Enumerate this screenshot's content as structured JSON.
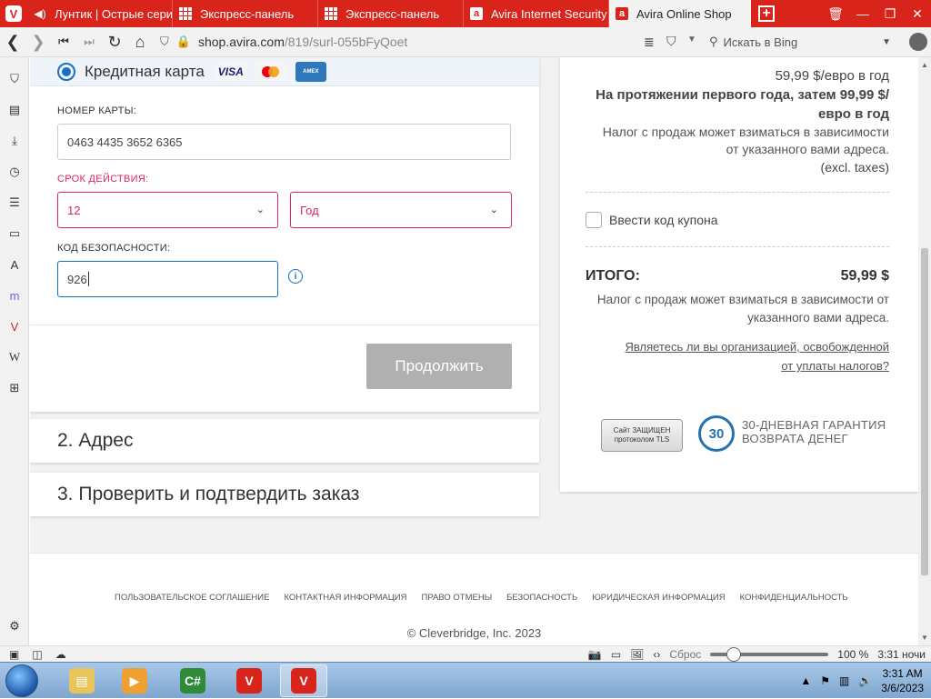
{
  "tabs": [
    {
      "label": "Лунтик | Острые серии",
      "icon": "speaker-icon"
    },
    {
      "label": "Экспресс-панель",
      "icon": "grid-icon"
    },
    {
      "label": "Экспресс-панель",
      "icon": "grid-icon"
    },
    {
      "label": "Avira Internet Security -",
      "icon": "avira-icon"
    },
    {
      "label": "Avira Online Shop",
      "icon": "avira-icon",
      "active": true
    }
  ],
  "address": {
    "host": "shop.avira.com",
    "path": "/819/surl-055bFyQoet",
    "search_placeholder": "Искать в Bing"
  },
  "payment": {
    "method_label": "Кредитная карта",
    "visa_label": "VISA",
    "amex_label": "AMEX",
    "card_number_label": "НОМЕР КАРТЫ:",
    "card_number_value": "0463 4435 3652 6365",
    "expiry_label": "СРОК ДЕЙСТВИЯ:",
    "expiry_month": "12",
    "expiry_year_placeholder": "Год",
    "cvv_label": "КОД БЕЗОПАСНОСТИ:",
    "cvv_value": "926",
    "continue_label": "Продолжить"
  },
  "steps": {
    "address": "2. Адрес",
    "review": "3. Проверить и подтвердить заказ"
  },
  "summary": {
    "price": "59,99 $/евро в год",
    "renewal_line1": "На протяжении первого года, затем 99,99 $/",
    "renewal_line2": "евро в год",
    "tax_note_line1": "Налог с продаж может взиматься в зависимости",
    "tax_note_line2": "от указанного вами адреса.",
    "excl_taxes": "(excl. taxes)",
    "coupon_label": "Ввести код купона",
    "total_label": "ИТОГО:",
    "total_value": "59,99 $",
    "total_tax_line1": "Налог с продаж может взиматься в зависимости от",
    "total_tax_line2": "указанного вами адреса.",
    "tax_exempt_line1": "Являетесь ли вы организацией, освобожденной",
    "tax_exempt_line2": "от уплаты налогов?",
    "tls_line1": "Сайт ЗАЩИЩЕН",
    "tls_line2": "протоколом TLS",
    "guarantee_number": "30",
    "guarantee_text": "30-ДНЕВНАЯ ГАРАНТИЯ ВОЗВРАТА ДЕНЕГ"
  },
  "footer": {
    "links": [
      "ПОЛЬЗОВАТЕЛЬСКОЕ СОГЛАШЕНИЕ",
      "КОНТАКТНАЯ ИНФОРМАЦИЯ",
      "ПРАВО ОТМЕНЫ",
      "БЕЗОПАСНОСТЬ",
      "ЮРИДИЧЕСКАЯ ИНФОРМАЦИЯ",
      "КОНФИДЕНЦИАЛЬНОСТЬ"
    ],
    "copyright": "© Cleverbridge, Inc. 2023"
  },
  "statusbar": {
    "reset_label": "Сброс",
    "zoom": "100 %",
    "time": "3:31 ночи"
  },
  "taskbar": {
    "clock_time": "3:31 AM",
    "clock_date": "3/6/2023",
    "csharp_label": "C#"
  },
  "colors": {
    "brand_red": "#d9241c",
    "accent_blue": "#1670c8",
    "error_pink": "#e0245e"
  }
}
